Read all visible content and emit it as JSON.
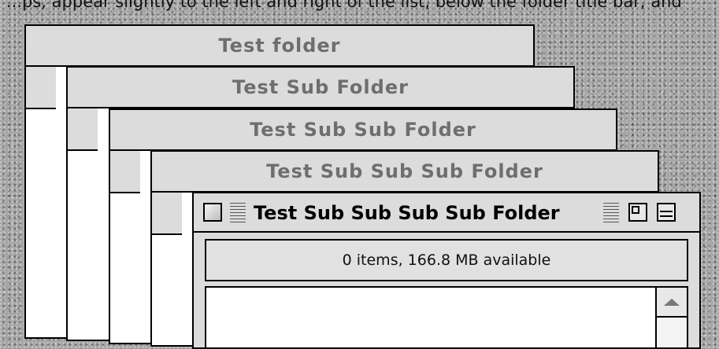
{
  "caption": {
    "text": "...ps, appear slightly to the left and right of the list, below the folder title bar, and"
  },
  "windows": [
    {
      "title": "Test folder"
    },
    {
      "title": "Test Sub Folder"
    },
    {
      "title": "Test Sub Sub Folder"
    },
    {
      "title": "Test Sub Sub Sub Folder"
    }
  ],
  "active_window": {
    "title": "Test Sub Sub Sub Sub Folder",
    "info": "0 items, 166.8 MB available"
  },
  "icons": {
    "close": "close-box",
    "grip": "title-grip",
    "zoom": "zoom-box",
    "collapse": "windowshade-box",
    "scroll_up": "scroll-up-arrow"
  },
  "colors": {
    "desktop": "#a6a6a6",
    "titlebar": "#dcdcdc",
    "inactive_title": "#6e6e6e",
    "active_title": "#000000",
    "list_bg": "#ffffff"
  }
}
